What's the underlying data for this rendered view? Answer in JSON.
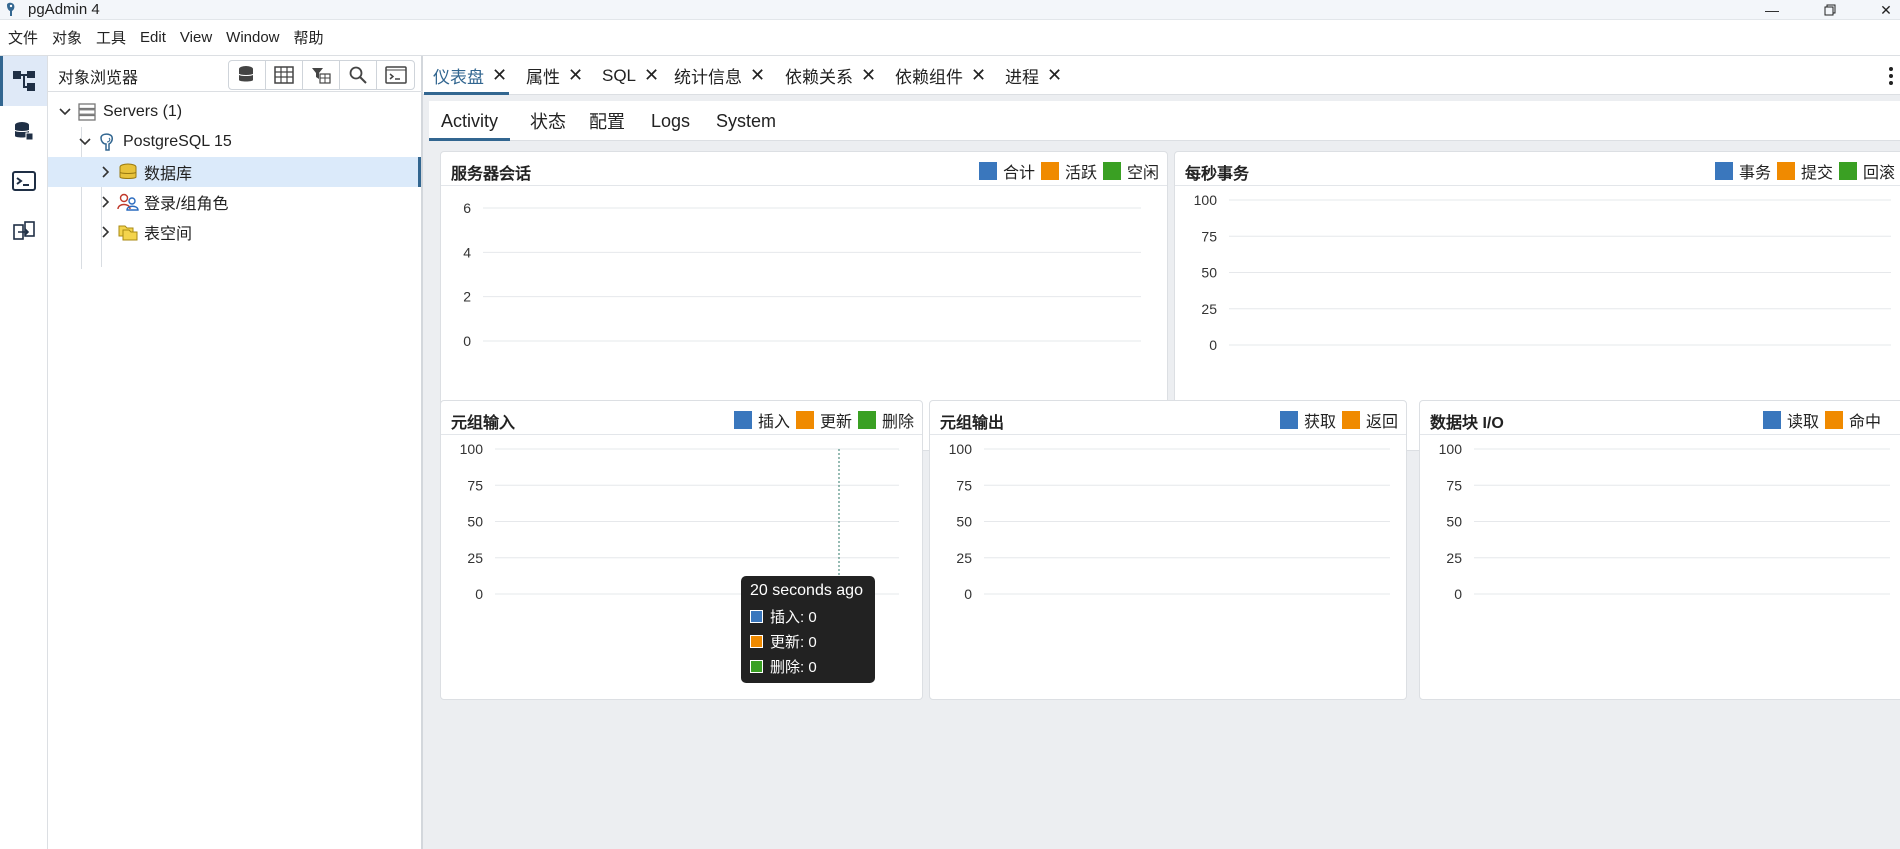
{
  "window": {
    "title": "pgAdmin 4"
  },
  "menu": [
    "文件",
    "对象",
    "工具",
    "Edit",
    "View",
    "Window",
    "帮助"
  ],
  "browser": {
    "title": "对象浏览器",
    "tree": {
      "servers": "Servers (1)",
      "server": "PostgreSQL 15",
      "databases": "数据库",
      "roles": "登录/组角色",
      "tablespaces": "表空间"
    }
  },
  "tabs": [
    "仪表盘",
    "属性",
    "SQL",
    "统计信息",
    "依赖关系",
    "依赖组件",
    "进程"
  ],
  "active_tab": "仪表盘",
  "subtabs": [
    "Activity",
    "状态",
    "配置",
    "Logs",
    "System"
  ],
  "active_subtab": "Activity",
  "colors": {
    "blue": "#3a77bd",
    "orange": "#f08a00",
    "green": "#3aa023",
    "accent": "#326690"
  },
  "charts": {
    "sessions": {
      "title": "服务器会话",
      "legend": [
        "合计",
        "活跃",
        "空闲"
      ]
    },
    "tps": {
      "title": "每秒事务",
      "legend": [
        "事务",
        "提交",
        "回滚"
      ]
    },
    "tuples_in": {
      "title": "元组输入",
      "legend": [
        "插入",
        "更新",
        "删除"
      ]
    },
    "tuples_out": {
      "title": "元组输出",
      "legend": [
        "获取",
        "返回"
      ]
    },
    "block_io": {
      "title": "数据块 I/O",
      "legend": [
        "读取",
        "命中"
      ]
    }
  },
  "chart_data": [
    {
      "type": "line",
      "title": "服务器会话",
      "yticks": [
        "6",
        "4",
        "2",
        "0"
      ],
      "ylim": [
        0,
        6
      ],
      "series": [
        {
          "name": "合计",
          "values": []
        },
        {
          "name": "活跃",
          "values": []
        },
        {
          "name": "空闲",
          "values": []
        }
      ]
    },
    {
      "type": "line",
      "title": "每秒事务",
      "yticks": [
        "100",
        "75",
        "50",
        "25",
        "0"
      ],
      "ylim": [
        0,
        100
      ],
      "series": [
        {
          "name": "事务",
          "values": []
        },
        {
          "name": "提交",
          "values": []
        },
        {
          "name": "回滚",
          "values": []
        }
      ]
    },
    {
      "type": "line",
      "title": "元组输入",
      "yticks": [
        "100",
        "75",
        "50",
        "25",
        "0"
      ],
      "ylim": [
        0,
        100
      ],
      "series": [
        {
          "name": "插入",
          "values": [
            0
          ]
        },
        {
          "name": "更新",
          "values": [
            0
          ]
        },
        {
          "name": "删除",
          "values": [
            0
          ]
        }
      ]
    },
    {
      "type": "line",
      "title": "元组输出",
      "yticks": [
        "100",
        "75",
        "50",
        "25",
        "0"
      ],
      "ylim": [
        0,
        100
      ],
      "series": [
        {
          "name": "获取",
          "values": []
        },
        {
          "name": "返回",
          "values": []
        }
      ]
    },
    {
      "type": "line",
      "title": "数据块 I/O",
      "yticks": [
        "100",
        "75",
        "50",
        "25",
        "0"
      ],
      "ylim": [
        0,
        100
      ],
      "series": [
        {
          "name": "读取",
          "values": []
        },
        {
          "name": "命中",
          "values": []
        }
      ]
    }
  ],
  "tooltip": {
    "title": "20 seconds ago",
    "rows": [
      {
        "label": "插入: 0"
      },
      {
        "label": "更新: 0"
      },
      {
        "label": "删除: 0"
      }
    ]
  }
}
